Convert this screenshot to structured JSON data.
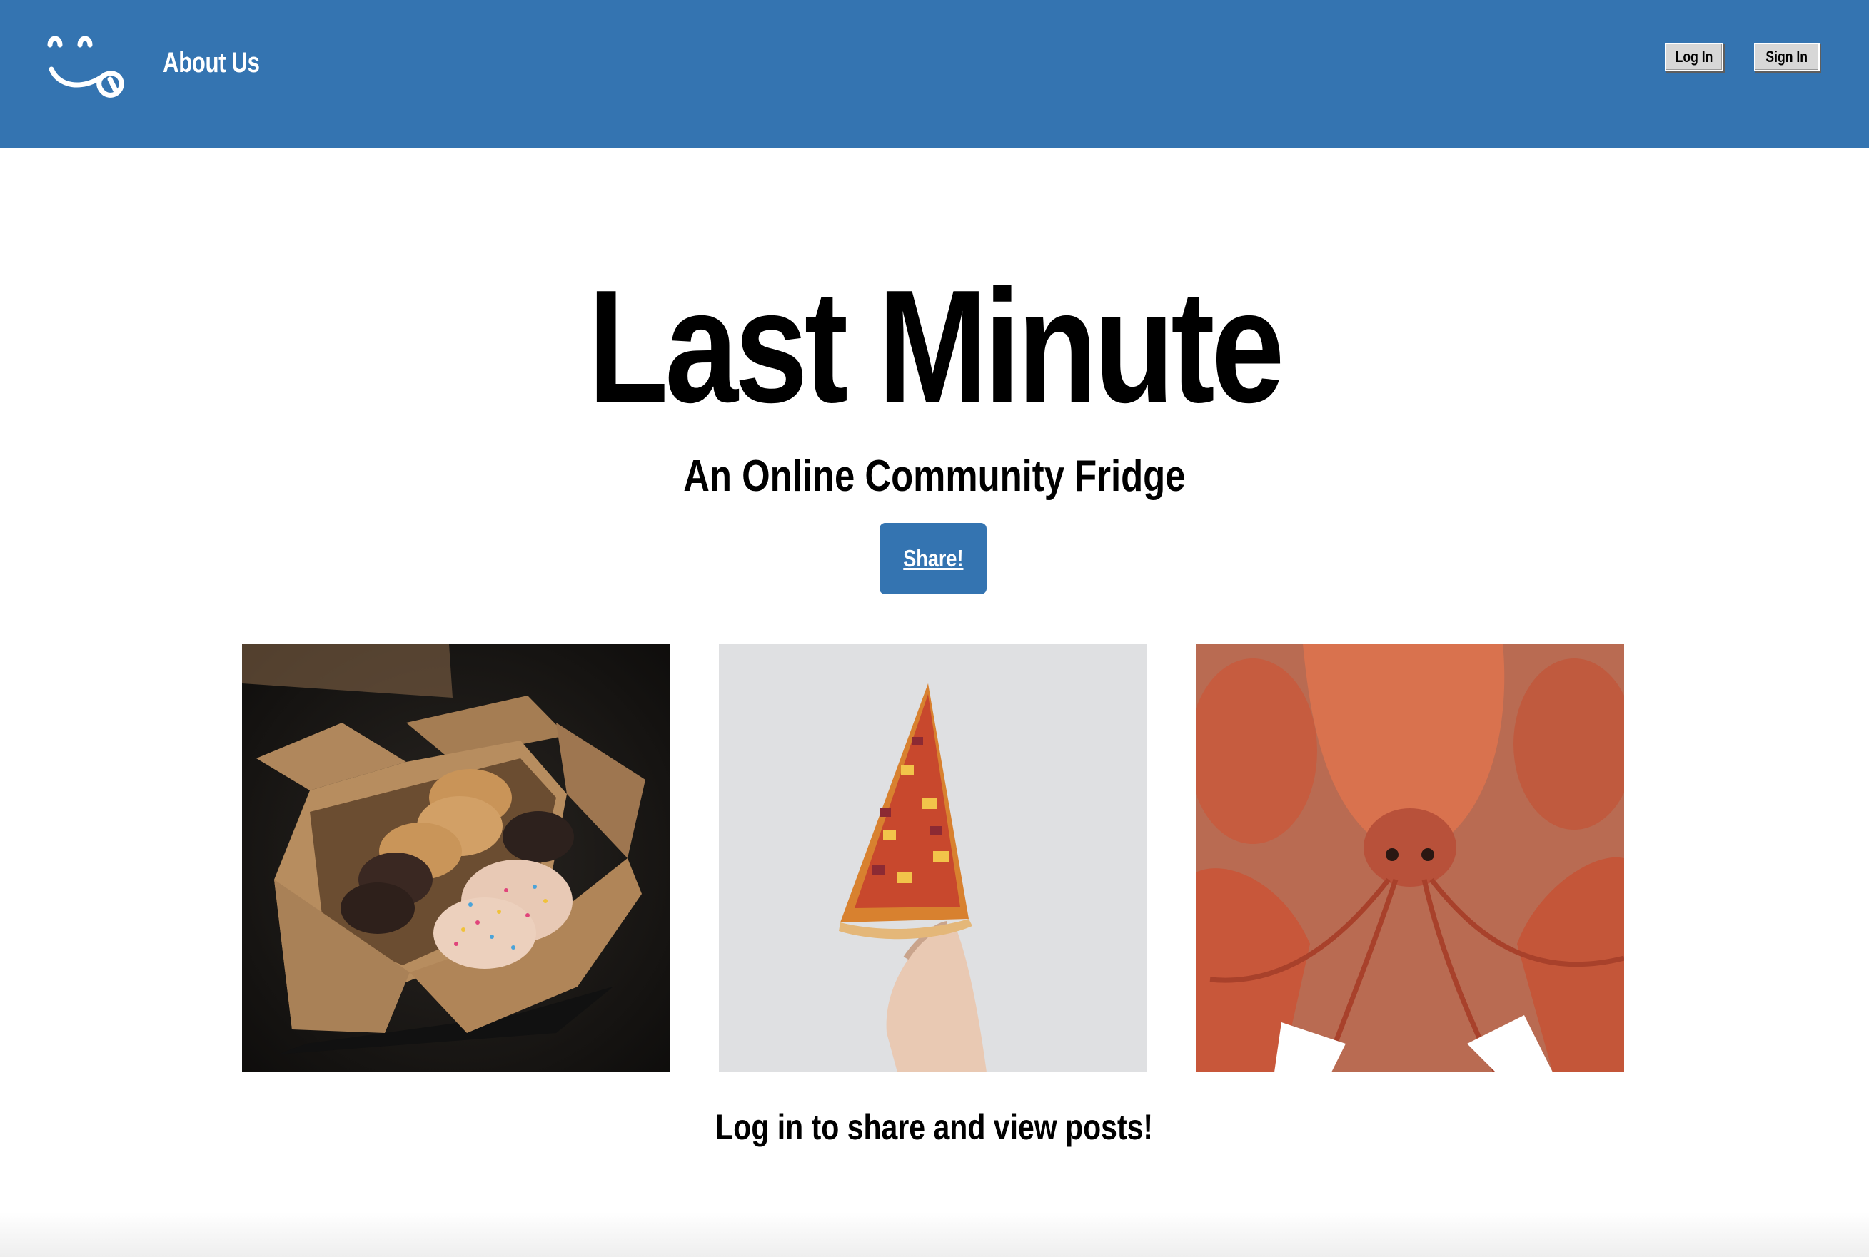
{
  "header": {
    "logo_icon": "smiley-face-logo-icon",
    "about_label": "About Us",
    "login_label": "Log In",
    "signin_label": "Sign In",
    "background_color": "#3474b1"
  },
  "hero": {
    "title": "Last Minute",
    "subtitle": "An Online Community Fridge",
    "share_label": "Share!",
    "accent_color": "#3474b1"
  },
  "gallery": [
    {
      "icon": "cookies-box-image"
    },
    {
      "icon": "pizza-slice-image"
    },
    {
      "icon": "lobster-image"
    }
  ],
  "footer": {
    "note": "Log in to share and view posts!"
  }
}
